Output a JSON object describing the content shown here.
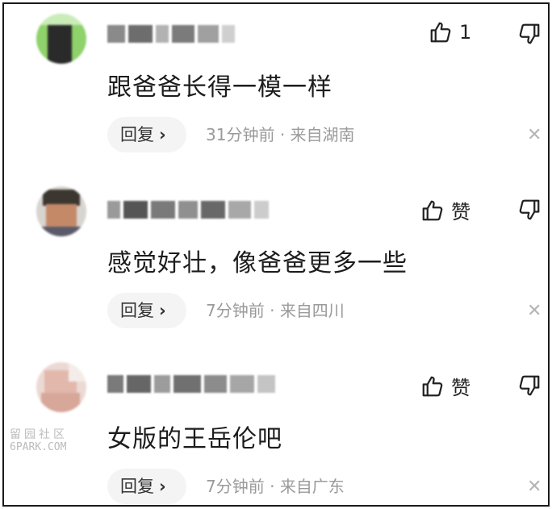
{
  "comments": [
    {
      "text": "跟爸爸长得一模一样",
      "like_label": "1",
      "reply_label": "回复",
      "time": "31分钟前",
      "location": "来自湖南"
    },
    {
      "text": "感觉好壮，像爸爸更多一些",
      "like_label": "赞",
      "reply_label": "回复",
      "time": "7分钟前",
      "location": "来自四川"
    },
    {
      "text": "女版的王岳伦吧",
      "like_label": "赞",
      "reply_label": "回复",
      "time": "7分钟前",
      "location": "来自广东"
    }
  ],
  "meta_separator": "·",
  "reply_chevron": "›",
  "close_symbol": "✕",
  "watermark": {
    "line1": "留园社区",
    "line2": "6PARK.COM"
  },
  "icons": {
    "like": "thumbs-up-icon",
    "dislike": "thumbs-down-icon",
    "close": "close-icon"
  }
}
